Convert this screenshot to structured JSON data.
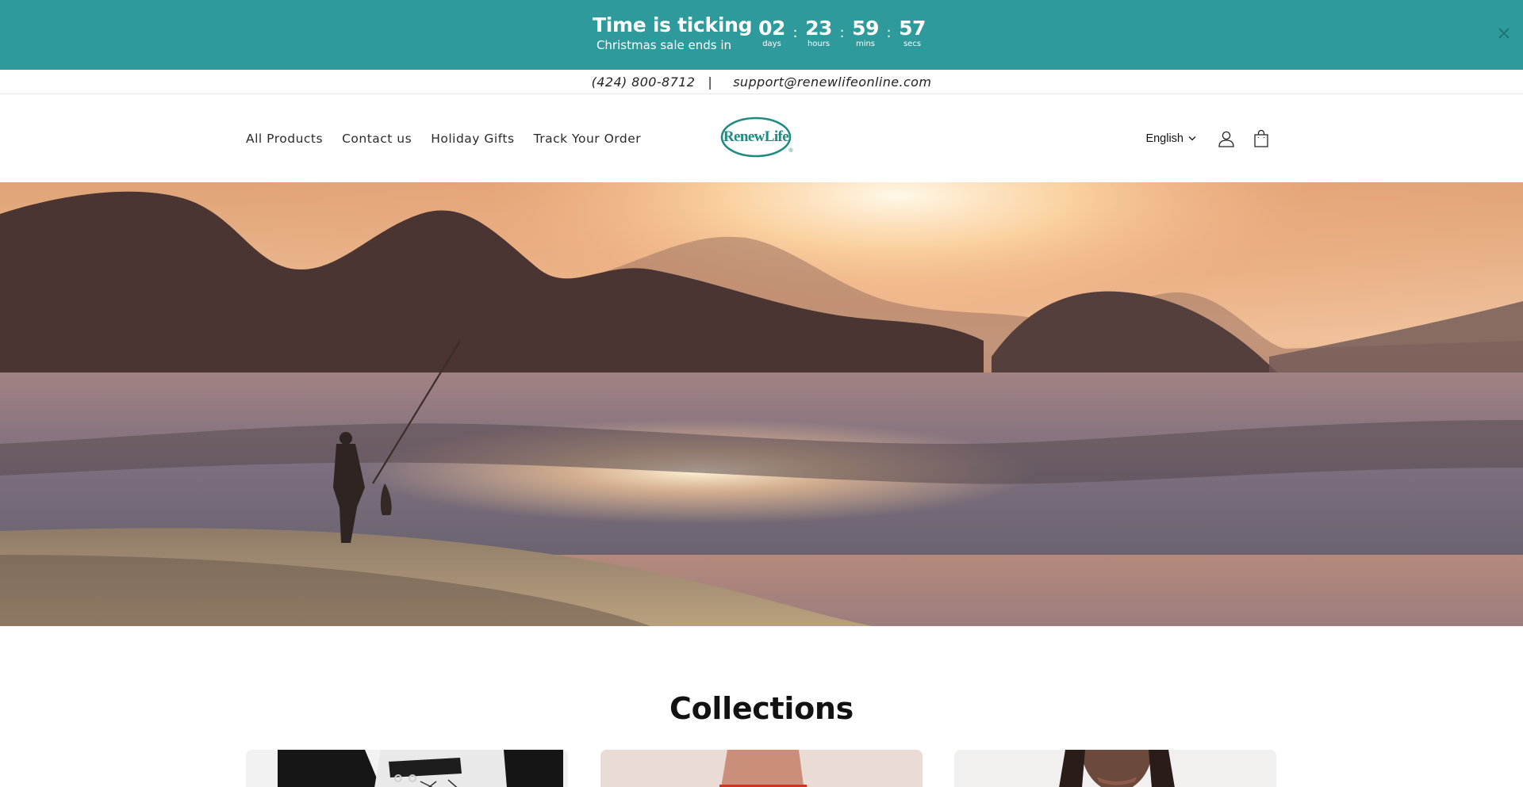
{
  "countdown": {
    "title": "Time is ticking",
    "subtitle": "Christmas sale ends in",
    "units": [
      {
        "value": "02",
        "label": "days"
      },
      {
        "value": "23",
        "label": "hours"
      },
      {
        "value": "59",
        "label": "mins"
      },
      {
        "value": "57",
        "label": "secs"
      }
    ],
    "separator": ":",
    "close_icon": "close-icon",
    "background_color": "#2e9a9b"
  },
  "contact": {
    "phone": "(424) 800-8712",
    "separator": "|",
    "email": "support@renewlifeonline.com"
  },
  "header": {
    "nav": [
      {
        "label": "All Products"
      },
      {
        "label": "Contact us"
      },
      {
        "label": "Holiday Gifts"
      },
      {
        "label": "Track Your Order"
      }
    ],
    "logo_text": "RenewLife",
    "logo_mark": "®",
    "language": "English",
    "icons": [
      "chevron-down-icon",
      "account-icon",
      "cart-icon"
    ]
  },
  "collections": {
    "title": "Collections"
  }
}
